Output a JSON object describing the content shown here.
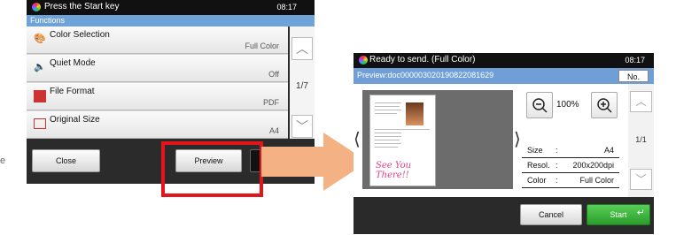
{
  "stray_text": "e",
  "left_screen": {
    "status_text": "Press the Start key",
    "time": "08:17",
    "section_label": "Functions",
    "items": [
      {
        "label": "Color Selection",
        "value": "Full Color"
      },
      {
        "label": "Quiet Mode",
        "value": "Off"
      },
      {
        "label": "File Format",
        "value": "PDF"
      },
      {
        "label": "Original Size",
        "value": "A4"
      }
    ],
    "page_indicator": "1/7",
    "close_label": "Close",
    "preview_label": "Preview"
  },
  "right_screen": {
    "status_text": "Ready to send. (Full Color)",
    "time": "08:17",
    "preview_label": "Preview:doc00000302019082208162​9",
    "no_label": "No.",
    "zoom": "100%",
    "info": [
      {
        "key": "Size",
        "value": "A4"
      },
      {
        "key": "Resol.",
        "value": "200x200dpi"
      },
      {
        "key": "Color",
        "value": "Full Color"
      }
    ],
    "page_indicator": "1/1",
    "cancel_label": "Cancel",
    "start_label": "Start",
    "thumbnail_caption": "See You There!!"
  },
  "colors": {
    "highlight": "#e5141b",
    "arrow": "#f4b183",
    "start": "#3cb43c",
    "bar": "#6fa3d8"
  }
}
